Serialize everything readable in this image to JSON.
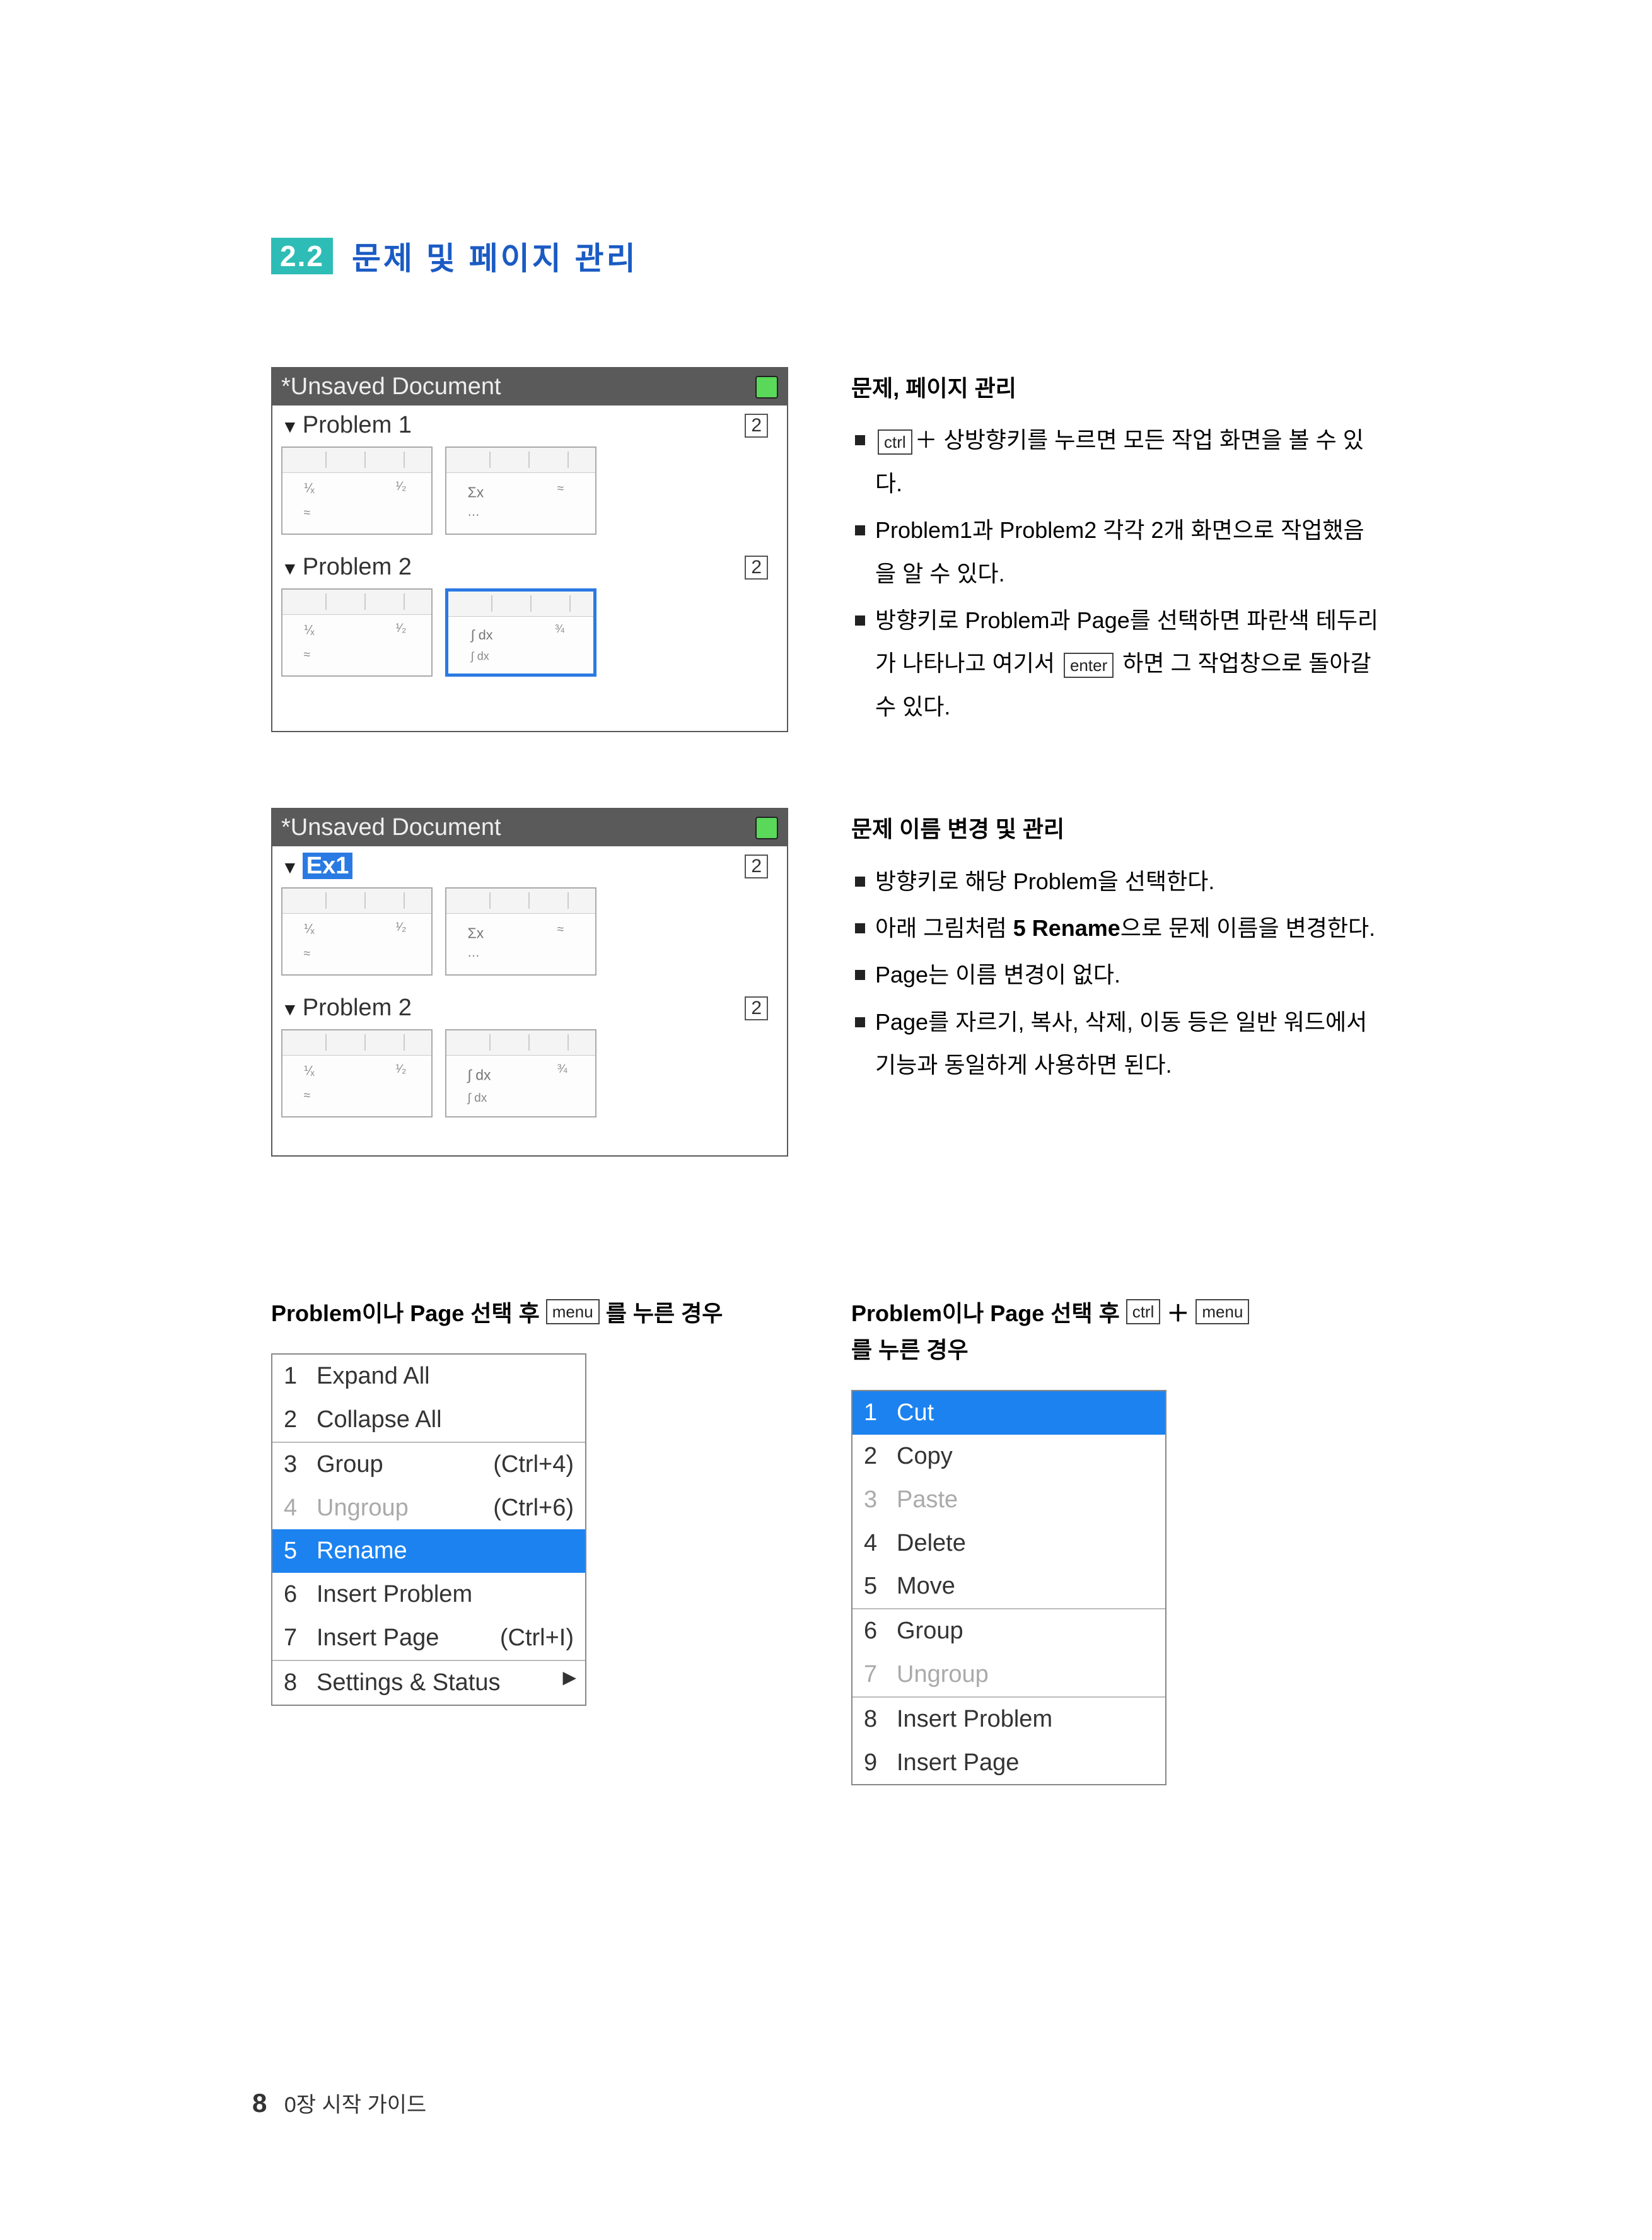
{
  "section": {
    "number": "2.2",
    "title": "문제 및 페이지 관리"
  },
  "row1": {
    "calc": {
      "title": "*Unsaved Document",
      "problems": [
        {
          "name": "Problem 1",
          "count": "2",
          "selected": false,
          "sel_thumb": -1
        },
        {
          "name": "Problem 2",
          "count": "2",
          "selected": false,
          "sel_thumb": 1
        }
      ]
    },
    "desc": {
      "title": "문제, 페이지 관리",
      "items": [
        {
          "pre": "",
          "key1": "ctrl",
          "mid": "＋ 상방향키를 누르면 모든 작업 화면을 볼 수 있다."
        },
        {
          "text": "Problem1과 Problem2 각각 2개 화면으로 작업했음을 알 수 있다."
        },
        {
          "pre": "방향키로 Problem과 Page를 선택하면 파란색 테두리가 나타나고 여기서 ",
          "key1": "enter",
          "mid": " 하면 그 작업창으로 돌아갈 수 있다."
        }
      ]
    }
  },
  "row2": {
    "calc": {
      "title": "*Unsaved Document",
      "problems": [
        {
          "name": "Ex1",
          "count": "2",
          "selected": true,
          "sel_thumb": -1
        },
        {
          "name": "Problem 2",
          "count": "2",
          "selected": false,
          "sel_thumb": -1
        }
      ]
    },
    "desc": {
      "title": "문제 이름 변경 및 관리",
      "items": [
        {
          "text": "방향키로 해당 Problem을 선택한다."
        },
        {
          "pre": "아래 그림처럼 ",
          "bold": "5 Rename",
          "mid": "으로 문제 이름을 변경한다."
        },
        {
          "text": "Page는 이름 변경이 없다."
        },
        {
          "text": "Page를 자르기, 복사, 삭제, 이동 등은 일반 워드에서 기능과 동일하게 사용하면 된다."
        }
      ]
    }
  },
  "menus": {
    "left": {
      "caption_pre": "Problem이나 Page 선택 후 ",
      "caption_key1": "menu",
      "caption_post": " 를 누른 경우",
      "items": [
        {
          "n": "1",
          "label": "Expand All",
          "shortcut": "",
          "sel": false,
          "disabled": false
        },
        {
          "n": "2",
          "label": "Collapse All",
          "shortcut": "",
          "sel": false,
          "disabled": false,
          "sep_after": true
        },
        {
          "n": "3",
          "label": "Group",
          "shortcut": "(Ctrl+4)",
          "sel": false,
          "disabled": false
        },
        {
          "n": "4",
          "label": "Ungroup",
          "shortcut": "(Ctrl+6)",
          "sel": false,
          "disabled": true
        },
        {
          "n": "5",
          "label": "Rename",
          "shortcut": "",
          "sel": true,
          "disabled": false
        },
        {
          "n": "6",
          "label": "Insert Problem",
          "shortcut": "",
          "sel": false,
          "disabled": false
        },
        {
          "n": "7",
          "label": "Insert Page",
          "shortcut": "(Ctrl+I)",
          "sel": false,
          "disabled": false,
          "sep_after": true
        },
        {
          "n": "8",
          "label": "Settings & Status",
          "shortcut": "",
          "sel": false,
          "disabled": false,
          "submenu": true
        }
      ]
    },
    "right": {
      "caption_pre": "Problem이나 Page 선택 후 ",
      "caption_key1": "ctrl",
      "caption_plus": "＋",
      "caption_key2": "menu",
      "caption_post": " 를 누른 경우",
      "items": [
        {
          "n": "1",
          "label": "Cut",
          "sel": true,
          "disabled": false
        },
        {
          "n": "2",
          "label": "Copy",
          "sel": false,
          "disabled": false
        },
        {
          "n": "3",
          "label": "Paste",
          "sel": false,
          "disabled": true
        },
        {
          "n": "4",
          "label": "Delete",
          "sel": false,
          "disabled": false
        },
        {
          "n": "5",
          "label": "Move",
          "sel": false,
          "disabled": false,
          "sep_after": true
        },
        {
          "n": "6",
          "label": "Group",
          "sel": false,
          "disabled": false
        },
        {
          "n": "7",
          "label": "Ungroup",
          "sel": false,
          "disabled": true,
          "sep_after": true
        },
        {
          "n": "8",
          "label": "Insert Problem",
          "sel": false,
          "disabled": false
        },
        {
          "n": "9",
          "label": "Insert Page",
          "sel": false,
          "disabled": false
        }
      ]
    }
  },
  "footer": {
    "page_number": "8",
    "chapter": "0장 시작 가이드"
  }
}
